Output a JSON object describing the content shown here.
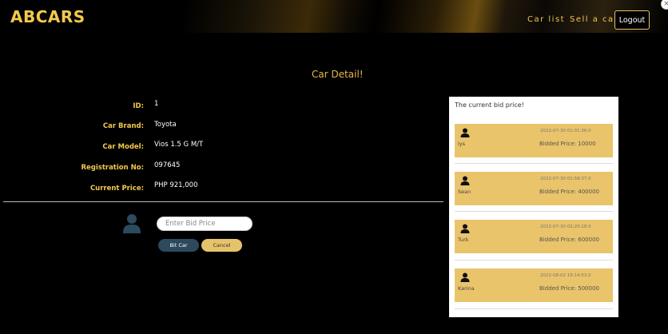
{
  "header": {
    "logo": "ABCARS",
    "nav": {
      "car_list": "Car list",
      "sell_car": "Sell a car"
    },
    "logout": "Logout"
  },
  "page_title": "Car Detail!",
  "details": {
    "id_label": "ID:",
    "id_value": "1",
    "brand_label": "Car Brand:",
    "brand_value": "Toyota",
    "model_label": "Car Model:",
    "model_value": "Vios 1.5 G M/T",
    "reg_label": "Registration No:",
    "reg_value": "097645",
    "price_label": "Current Price:",
    "price_value": "PHP 921,000"
  },
  "bid_form": {
    "placeholder": "Enter Bid Price",
    "bid_button": "Bit Car",
    "cancel_button": "Cancel"
  },
  "bid_panel": {
    "title": "The current bid price!",
    "bids": [
      {
        "user": "iys",
        "time": "2022-07-30 01:01:36.0",
        "price": "Bidded Price: 10000"
      },
      {
        "user": "Sean",
        "time": "2022-07-30 01:58:37.0",
        "price": "Bidded Price: 400000"
      },
      {
        "user": "Turk",
        "time": "2022-07-30 02:20:18.0",
        "price": "Bidded Price: 600000"
      },
      {
        "user": "Karina",
        "time": "2022-08-02 19:14:53.0",
        "price": "Bidded Price: 500000"
      }
    ]
  },
  "colors": {
    "accent": "#e9c46a",
    "brand": "#f2c94c",
    "dark_button": "#2c4a5c",
    "background": "#000000"
  }
}
